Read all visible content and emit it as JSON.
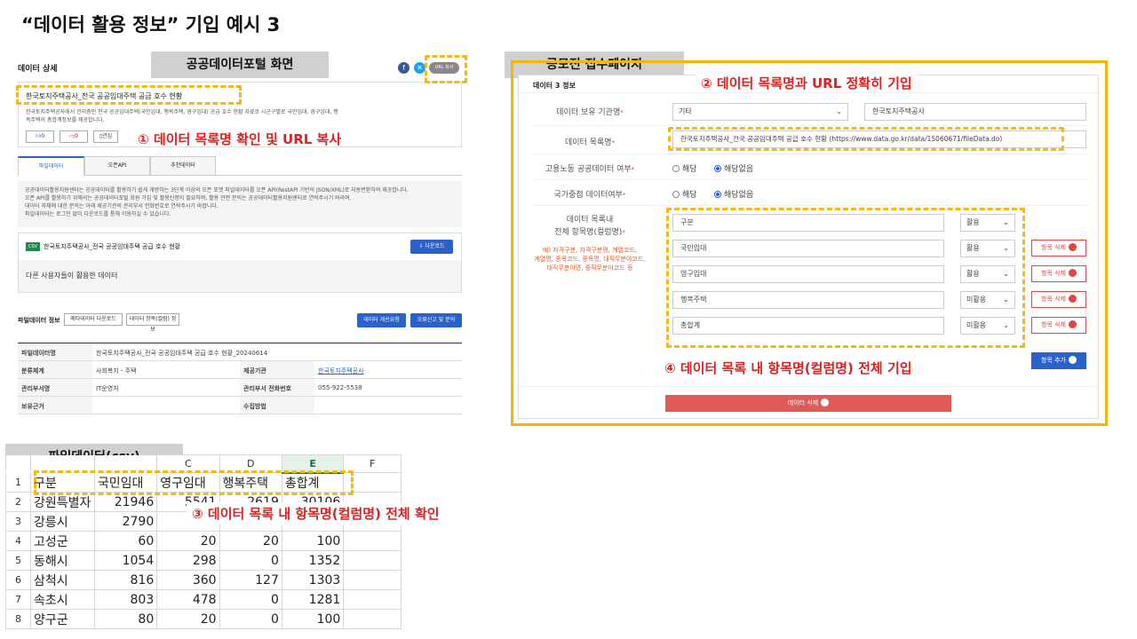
{
  "page_title": "“데이터 활용 정보” 기입 예시 3",
  "labels": {
    "portal": "공공데이터포털 화면",
    "contest": "공모전 접수페이지",
    "csv": "파일데이터(csv)"
  },
  "annotations": {
    "a1": "① 데이터 목록명 확인 및 URL 복사",
    "a2": "② 데이터 목록명과 URL 정확히 기입",
    "a3": "③ 데이터 목록 내 항목명(컬럼명) 전체 확인",
    "a4": "④ 데이터 목록 내 항목명(컬럼명) 전체 기입"
  },
  "colors": {
    "accent_yellow": "#f5b800",
    "red": "#e02020",
    "blue": "#2a62c9"
  },
  "portal": {
    "header": "데이터 상세",
    "url_copy": "URL 복사",
    "dataset_title": "한국토지주택공사_전국 공공임대주택 공급 호수 현황",
    "desc1": "한국토지주택공사에서 관리중인 전국 공공임대주택(국민임대, 행복주택, 영구임대) 공급 호수 현황 자료로 시군구별로 국민임대, 영구임대, 행",
    "desc2": "복주택의 총합계정보를 제공합니다.",
    "like": "0",
    "dislike": "0",
    "bookmark": "관심",
    "tabs": [
      "파일데이터",
      "오픈API",
      "추천데이터"
    ],
    "notice": [
      "공공데이터활용지원센터는 공공데이터를 활용하기 쉽게 개방하는 3단계 이상의 오픈 포맷 파일데이터를 오픈 API(RestAPI 기반의 JSON/XML)로 자동변환하여 제공합니다.",
      "오픈 API를 활용하기 위해서는 공공데이터포털 회원 가입 및 활용신청이 필요하며, 활용 관련 문의는 공공데이터활용지원센터로 연락주시기 바라며,",
      "데이터 자체에 대한 문의는 아래 제공기관의 관리부서 전화번호로 연락주시기 바랍니다.",
      "파일데이터는 로그인 없이 다운로드를 통해 이용하실 수 있습니다."
    ],
    "csv_badge": "CSV",
    "file_name": "한국토지주택공사_전국 공공임대주택 공급 호수 현황",
    "download": "다운로드",
    "others_used": "다른 사용자들이 활용한 데이터",
    "fileinfo_title": "파일데이터 정보",
    "meta_download": "메타데이터 다운로드",
    "item_info": "데이터 항목(컬럼) 정보",
    "improve_request": "데이터 개선요청",
    "error_report": "오류신고 및 문의",
    "info_rows": [
      {
        "k1": "파일데이터명",
        "v1": "한국토지주택공사_전국 공공임대주택 공급 호수 현황_20240614",
        "k2": "",
        "v2": ""
      },
      {
        "k1": "분류체계",
        "v1": "사회복지 - 주택",
        "k2": "제공기관",
        "v2": "한국토지주택공사"
      },
      {
        "k1": "관리부서명",
        "v1": "IT운영처",
        "k2": "관리부서 전화번호",
        "v2": "055-922-5538"
      },
      {
        "k1": "보유근거",
        "v1": "",
        "k2": "수집방법",
        "v2": ""
      }
    ]
  },
  "form": {
    "section_title": "데이터 3 정보",
    "owner_label": "데이터 보유 기관명",
    "owner_select": "기타",
    "owner_value": "한국토지주택공사",
    "list_label": "데이터 목록명",
    "list_value": "한국토지주택공사_전국 공공임대주택 공급 호수 현황 (https://www.data.go.kr/data/15060671/fileData.do)",
    "labor_label": "고용노동 공공데이터 여부",
    "national_label": "국가중점 데이터여부",
    "radio_yes": "해당",
    "radio_no": "해당없음",
    "items_label_1": "데이터 목록내",
    "items_label_2": "전체 항목명(컬럼명)",
    "items_example": [
      "예) 자격구분, 자격구분명, 계열코드,",
      "계열명, 종목코드, 종목명, 대직무분야코드,",
      "대직무분야명, 중직무분야코드 등"
    ],
    "items": [
      {
        "name": "구분",
        "use": "활용",
        "del": false
      },
      {
        "name": "국민임대",
        "use": "활용",
        "del": true
      },
      {
        "name": "영구임대",
        "use": "활용",
        "del": true
      },
      {
        "name": "행복주택",
        "use": "미활용",
        "del": true
      },
      {
        "name": "총합계",
        "use": "미활용",
        "del": true
      }
    ],
    "item_delete": "항목 삭제",
    "item_add": "항목 추가",
    "data_delete": "데이터 삭제"
  },
  "sheet": {
    "col_letters": [
      "C",
      "D",
      "E",
      "F"
    ],
    "rows": [
      {
        "n": "1",
        "cells": [
          "구분",
          "국민임대",
          "영구임대",
          "행복주택",
          "총합계"
        ]
      },
      {
        "n": "2",
        "cells": [
          "강원특별자",
          "21946",
          "5541",
          "2619",
          "30106"
        ]
      },
      {
        "n": "3",
        "cells": [
          "강릉시",
          "2790",
          "",
          "",
          ""
        ]
      },
      {
        "n": "4",
        "cells": [
          "고성군",
          "60",
          "20",
          "20",
          "100"
        ]
      },
      {
        "n": "5",
        "cells": [
          "동해시",
          "1054",
          "298",
          "0",
          "1352"
        ]
      },
      {
        "n": "6",
        "cells": [
          "삼척시",
          "816",
          "360",
          "127",
          "1303"
        ]
      },
      {
        "n": "7",
        "cells": [
          "속초시",
          "803",
          "478",
          "0",
          "1281"
        ]
      },
      {
        "n": "8",
        "cells": [
          "양구군",
          "80",
          "20",
          "0",
          "100"
        ]
      }
    ]
  }
}
